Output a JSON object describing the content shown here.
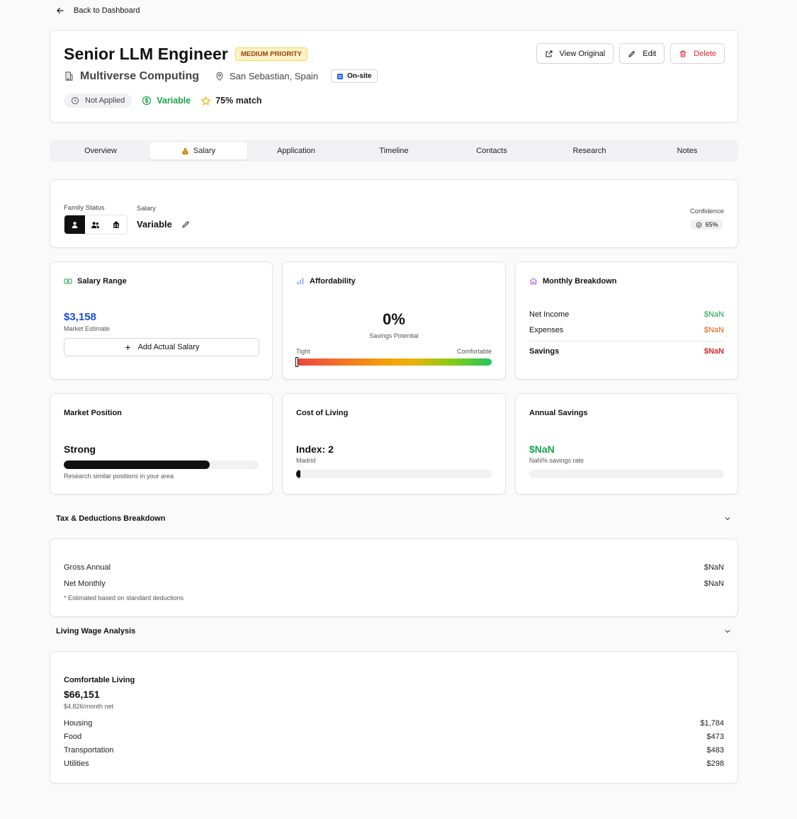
{
  "nav": {
    "back_label": "Back to Dashboard"
  },
  "job": {
    "title": "Senior LLM Engineer",
    "priority": "MEDIUM PRIORITY",
    "company": "Multiverse Computing",
    "location": "San Sebastian, Spain",
    "work_mode": "On-site",
    "status": "Not Applied",
    "salary_type": "Variable",
    "match": "75% match"
  },
  "actions": {
    "view_original": "View Original",
    "edit": "Edit",
    "delete": "Delete"
  },
  "tabs": [
    {
      "label": "Overview"
    },
    {
      "label": "Salary",
      "icon": "money-bag-icon",
      "active": true
    },
    {
      "label": "Application"
    },
    {
      "label": "Timeline"
    },
    {
      "label": "Contacts"
    },
    {
      "label": "Research"
    },
    {
      "label": "Notes"
    }
  ],
  "salary_panel": {
    "family_status_label": "Family Status",
    "family_options": [
      "single-person-icon",
      "couple-icon",
      "family-home-icon"
    ],
    "family_selected": 0,
    "salary_label": "Salary",
    "salary_value": "Variable",
    "confidence_label": "Confidence",
    "confidence_value": "65%"
  },
  "salary_range": {
    "title": "Salary Range",
    "estimate": "$3,158",
    "estimate_label": "Market Estimate",
    "add_button": "Add Actual Salary"
  },
  "affordability": {
    "title": "Affordability",
    "savings_pct": "0%",
    "savings_label": "Savings Potential",
    "scale_low": "Tight",
    "scale_high": "Comfortable",
    "level": 0
  },
  "monthly_breakdown": {
    "title": "Monthly Breakdown",
    "net_income_label": "Net Income",
    "net_income": "$NaN",
    "expenses_label": "Expenses",
    "expenses": "$NaN",
    "savings_label": "Savings",
    "savings": "$NaN"
  },
  "market_position": {
    "title": "Market Position",
    "value": "Strong",
    "level": 0.75,
    "note": "Research similar positions in your area"
  },
  "cost_of_living": {
    "title": "Cost of Living",
    "value": "Index: 2",
    "city": "Madrid",
    "level": 0.02
  },
  "annual_savings": {
    "title": "Annual Savings",
    "value": "$NaN",
    "rate": "NaN% savings rate",
    "level": 0
  },
  "tax": {
    "header": "Tax & Deductions Breakdown",
    "gross_label": "Gross Annual",
    "gross": "$NaN",
    "net_label": "Net Monthly",
    "net": "$NaN",
    "note": "* Estimated based on standard deductions"
  },
  "living_wage": {
    "header": "Living Wage Analysis",
    "title": "Comfortable Living",
    "annual": "$66,151",
    "monthly": "$4,826/month net",
    "items": [
      {
        "label": "Housing",
        "value": "$1,784"
      },
      {
        "label": "Food",
        "value": "$473"
      },
      {
        "label": "Transportation",
        "value": "$483"
      },
      {
        "label": "Utilities",
        "value": "$298"
      }
    ]
  },
  "colors": {
    "accent_green": "#16a34a",
    "accent_blue": "#1d4ed8",
    "danger": "#dc2626",
    "warning": "#ea580c"
  }
}
